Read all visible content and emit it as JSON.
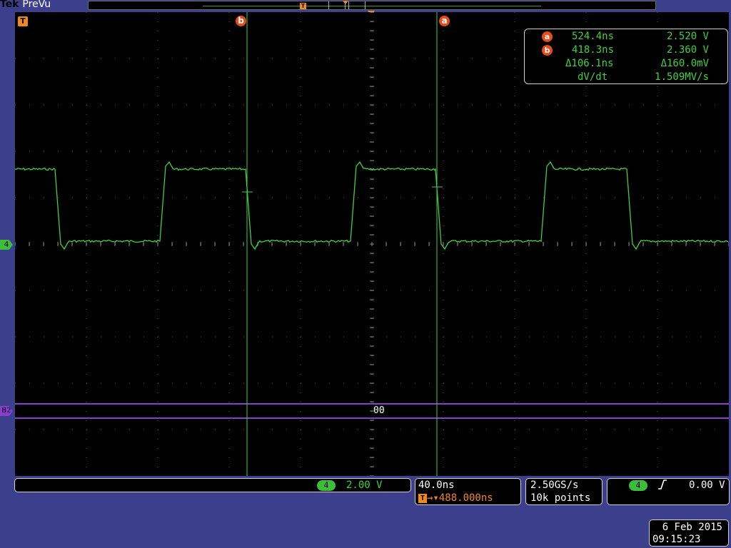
{
  "header": {
    "brand": "Tek",
    "mode": "PreVu",
    "record_trigger_marker": "T"
  },
  "graticule": {
    "trigger_badge": "T",
    "ch4_level_badge": "4",
    "bus_badge": "B2",
    "bus_value": "00",
    "cursor_a_label": "a",
    "cursor_b_label": "b"
  },
  "cursor_readout": {
    "a": {
      "badge": "a",
      "time": "524.4ns",
      "volt": "2.520 V"
    },
    "b": {
      "badge": "b",
      "time": "418.3ns",
      "volt": "2.360 V"
    },
    "delta": {
      "time": "Δ106.1ns",
      "volt": "Δ160.0mV"
    },
    "slope": {
      "label": "dV/dt",
      "value": "1.509MV/s"
    }
  },
  "vertical": {
    "channel": "4",
    "scale": "2.00 V"
  },
  "horizontal": {
    "scale": "40.0ns",
    "trigger_icon": "T",
    "position": "→▾488.000ns"
  },
  "acquisition": {
    "sample_rate": "2.50GS/s",
    "record_length": "10k points"
  },
  "trigger": {
    "channel": "4",
    "slope_icon": "rising-edge-icon",
    "slope_glyph": "⨍",
    "level": "0.00 V"
  },
  "datetime": {
    "date": "6 Feb 2015",
    "time": "09:15:23"
  },
  "colors": {
    "background": "#3c3f8c",
    "screen": "#000000",
    "ch4": "#3fd23f",
    "bus": "#8a3ccf",
    "cursor": "#3fd23f",
    "trigger": "#f08a1c",
    "cursor_badge": "#e84a18"
  },
  "waveform": {
    "channel": "4",
    "high_level_div": 1.5,
    "low_level_div": 0.0,
    "period_ns": 212.3,
    "duty_high_ns": 106.1
  }
}
